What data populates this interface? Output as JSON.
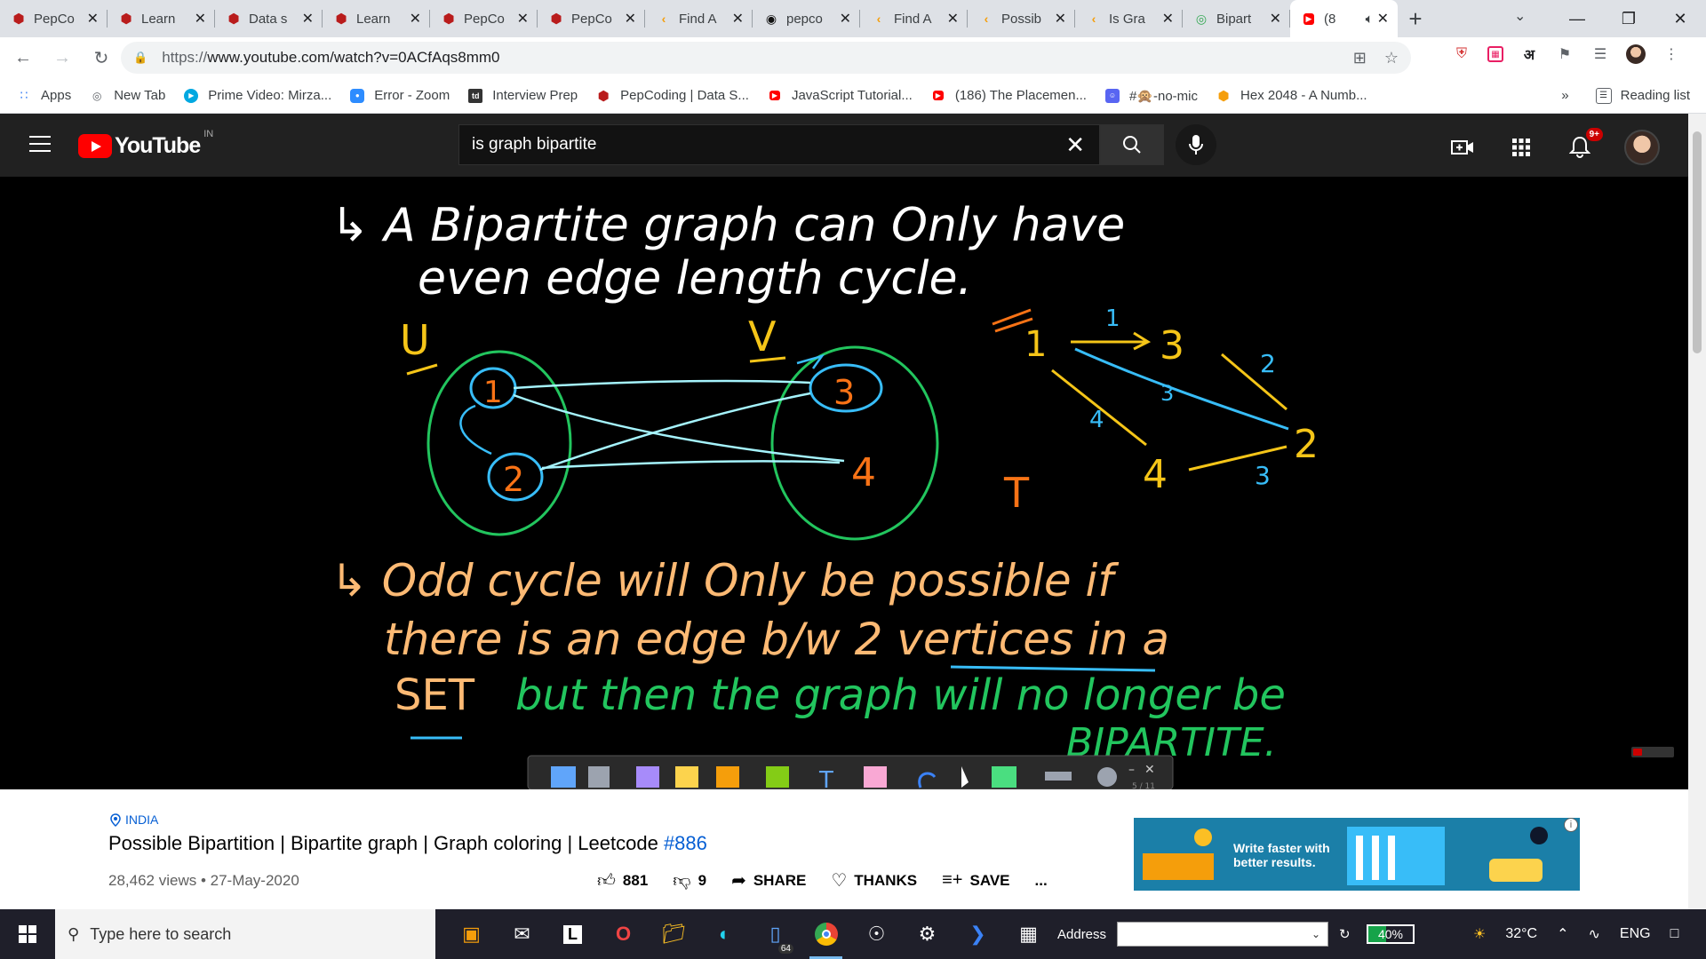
{
  "browser": {
    "tabs": [
      {
        "title": "PepCo",
        "icon": "pepcoding-icon"
      },
      {
        "title": "Learn",
        "icon": "pepcoding-icon"
      },
      {
        "title": "Data s",
        "icon": "pepcoding-icon"
      },
      {
        "title": "Learn",
        "icon": "pepcoding-icon"
      },
      {
        "title": "PepCo",
        "icon": "pepcoding-icon"
      },
      {
        "title": "PepCo",
        "icon": "pepcoding-icon"
      },
      {
        "title": "Find A",
        "icon": "leetcode-icon"
      },
      {
        "title": "pepco",
        "icon": "github-icon"
      },
      {
        "title": "Find A",
        "icon": "leetcode-icon"
      },
      {
        "title": "Possib",
        "icon": "leetcode-icon"
      },
      {
        "title": "Is Gra",
        "icon": "leetcode-icon"
      },
      {
        "title": "Bipart",
        "icon": "globe-icon"
      },
      {
        "title": "(8",
        "icon": "youtube-icon"
      }
    ],
    "url_scheme": "https://",
    "url_rest": "www.youtube.com/watch?v=0ACfAqs8mm0",
    "bookmarks": [
      {
        "label": "Apps",
        "icon": "apps-grid-icon"
      },
      {
        "label": "New Tab",
        "icon": "globe-icon"
      },
      {
        "label": "Prime Video: Mirza...",
        "icon": "prime-video-icon"
      },
      {
        "label": "Error - Zoom",
        "icon": "zoom-icon"
      },
      {
        "label": "Interview Prep",
        "icon": "td-icon"
      },
      {
        "label": "PepCoding | Data S...",
        "icon": "pepcoding-icon"
      },
      {
        "label": "JavaScript Tutorial...",
        "icon": "youtube-icon"
      },
      {
        "label": "(186) The Placemen...",
        "icon": "youtube-icon"
      },
      {
        "label": "#🙊-no-mic",
        "icon": "discord-icon"
      },
      {
        "label": "Hex 2048 - A Numb...",
        "icon": "hex-game-icon"
      }
    ],
    "more_bookmarks": "»",
    "reading_list": "Reading list",
    "ext_hindi": "अ"
  },
  "youtube": {
    "country": "IN",
    "search_query": "is graph bipartite",
    "notif_badge": "9+"
  },
  "whiteboard": {
    "line1a": "↳ A Bipartite graph can Only have",
    "line1b": "even edge length cycle.",
    "label_u": "U",
    "label_v": "V",
    "node1": "1",
    "node2": "2",
    "node3": "3",
    "node4": "4",
    "label_t": "T",
    "edge_w1": "1",
    "edge_w2": "2",
    "edge_w3a": "3",
    "edge_w3b": "3",
    "edge_w4": "4",
    "line2a": "↳ Odd cycle will Only be possible if",
    "line2b": "there is an edge b/w 2 vertices in a",
    "line2c_set": "SET",
    "line2c_rest": "but then the graph will no longer be",
    "line2d": "BIPARTITE.",
    "page_counter": "5 / 11"
  },
  "video": {
    "location": "INDIA",
    "title": "Possible Bipartition | Bipartite graph | Graph coloring | Leetcode ",
    "title_tag": "#886",
    "meta": "28,462 views • 27-May-2020",
    "likes": "881",
    "dislikes": "9",
    "share": "SHARE",
    "thanks": "THANKS",
    "save": "SAVE",
    "more": "..."
  },
  "ad": {
    "text_line1": "Write faster with",
    "text_line2": "better results."
  },
  "taskbar": {
    "search_placeholder": "Type here to search",
    "address_label": "Address",
    "battery": "40%",
    "battery_level": 0.4,
    "temperature": "32°C",
    "language": "ENG",
    "mail_count": "64"
  }
}
